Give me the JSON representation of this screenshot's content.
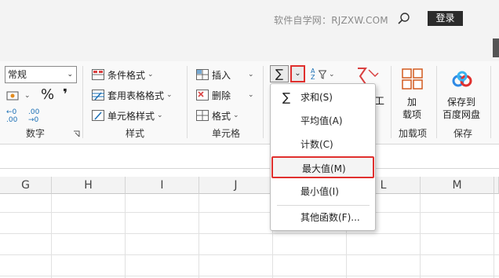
{
  "titlebar": {
    "watermark": "软件自学网：RJZXW.COM",
    "login_label": "登录"
  },
  "ribbon": {
    "number_format_value": "常规",
    "number_group_label": "数字",
    "percent_symbol": "%",
    "comma_symbol": "❜",
    "inc_decimal_label": "←0 .00",
    "dec_decimal_label": ".00 →0",
    "styles": {
      "conditional_format": "条件格式",
      "table_format": "套用表格格式",
      "cell_styles": "单元格样式",
      "group_label": "样式"
    },
    "cells": {
      "insert": "插入",
      "delete": "删除",
      "format": "格式",
      "group_label": "单元格"
    },
    "editing": {
      "sum_symbol": "∑",
      "sort_label": "A Z",
      "partial_letter": "工"
    },
    "addins": {
      "button_line1": "加",
      "button_line2": "载项",
      "group_label": "加载项"
    },
    "save": {
      "button_line1": "保存到",
      "button_line2": "百度网盘",
      "group_label": "保存"
    }
  },
  "sheet": {
    "columns": [
      "G",
      "H",
      "I",
      "J",
      "L",
      "M"
    ]
  },
  "autosum_menu": {
    "items": [
      {
        "label": "求和(S)"
      },
      {
        "label": "平均值(A)"
      },
      {
        "label": "计数(C)"
      },
      {
        "label": "最大值(M)"
      },
      {
        "label": "最小值(I)"
      },
      {
        "label": "其他函数(F)..."
      }
    ]
  },
  "colors": {
    "highlight": "#e0302e",
    "ribbon_bg": "#f9f9f9",
    "title_bg": "#f3f3f3"
  }
}
